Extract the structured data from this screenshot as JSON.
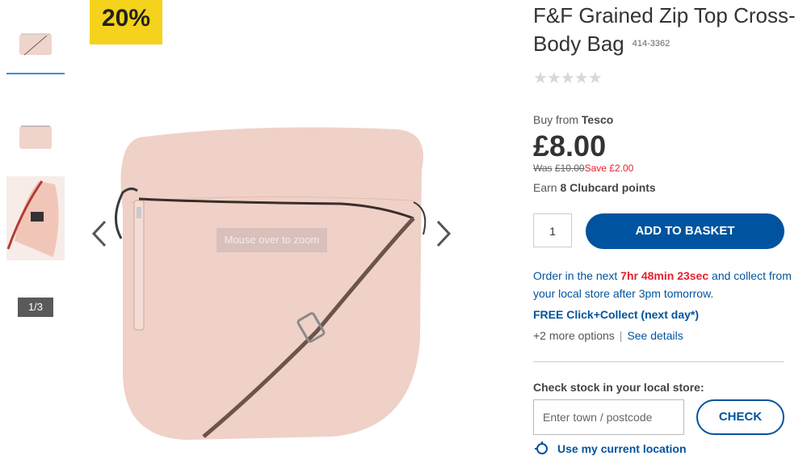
{
  "gallery": {
    "counter": "1/3",
    "badge": "20%",
    "zoom_hint": "Mouse over to zoom",
    "thumbnails": [
      "thumb-front",
      "thumb-back",
      "thumb-inside"
    ],
    "icons": {
      "prev": "chevron-left-icon",
      "next": "chevron-right-icon"
    }
  },
  "product": {
    "title": "F&F Grained Zip Top Cross-Body Bag",
    "sku": "414-3362",
    "rating_stars": "★★★★★",
    "buy_from_prefix": "Buy from",
    "seller": "Tesco",
    "price": "£8.00",
    "was_label": "Was",
    "was_price": "£10.00",
    "save_text": "Save £2.00",
    "earn_prefix": "Earn",
    "clubcard": "8 Clubcard points"
  },
  "basket": {
    "quantity": "1",
    "add_label": "ADD TO BASKET"
  },
  "delivery": {
    "order_prefix": "Order in the next",
    "countdown": "7hr 48min 23sec",
    "order_suffix": "and collect from your local store after 3pm tomorrow.",
    "free_collect": "FREE Click+Collect (next day*)",
    "more_options": "+2 more options",
    "see_details": "See details"
  },
  "stock": {
    "label": "Check stock in your local store:",
    "placeholder": "Enter town / postcode",
    "check_label": "CHECK",
    "use_location": "Use my current location"
  },
  "colors": {
    "brand_blue": "#00539f",
    "sale_red": "#e5202e",
    "badge_yellow": "#f5d21c",
    "bag_pink": "#efd1c8"
  }
}
